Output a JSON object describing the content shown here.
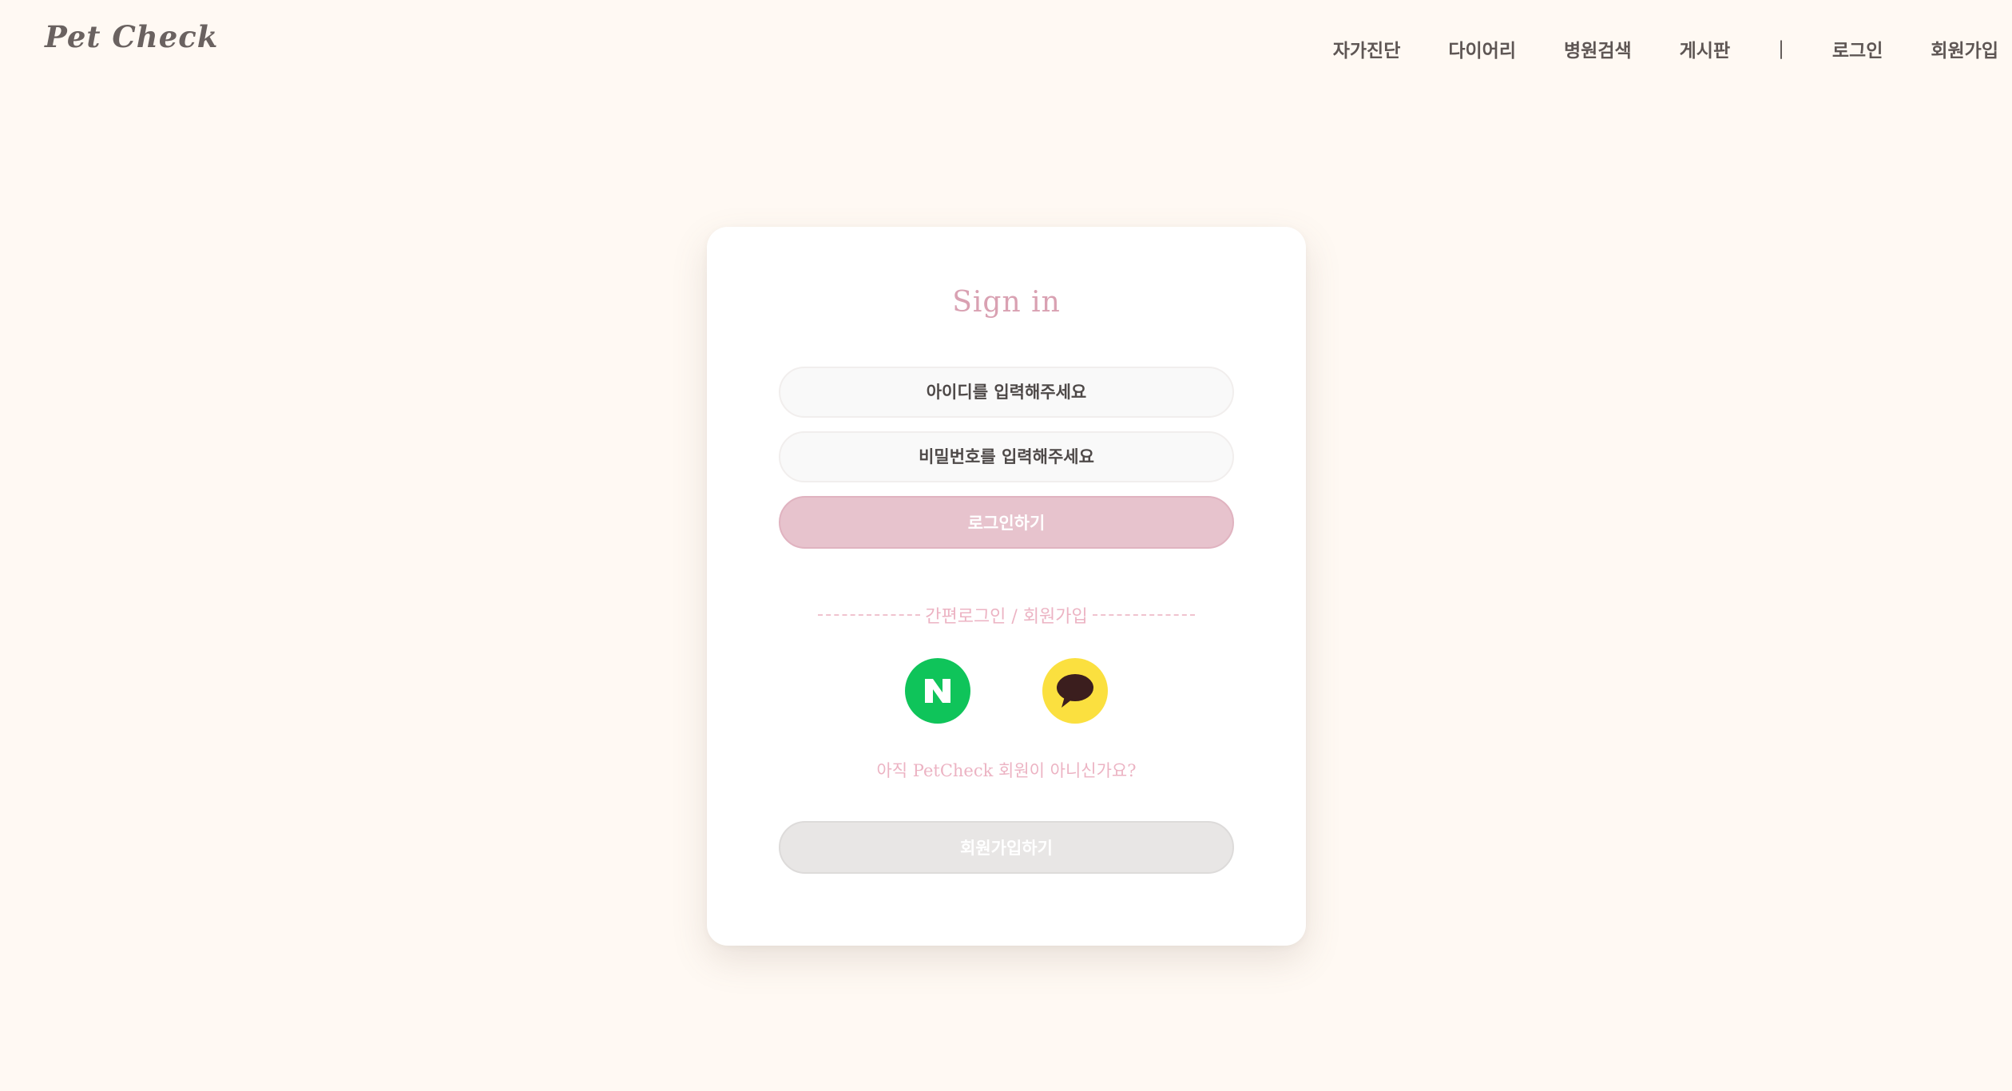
{
  "header": {
    "logo": "Pet Check",
    "nav": [
      {
        "label": "자가진단"
      },
      {
        "label": "다이어리"
      },
      {
        "label": "병원검색"
      },
      {
        "label": "게시판"
      }
    ],
    "separator": "|",
    "login": "로그인",
    "signup": "회원가입"
  },
  "card": {
    "title": "Sign in",
    "id_placeholder": "아이디를 입력해주세요",
    "pw_placeholder": "비밀번호를 입력해주세요",
    "login_button": "로그인하기",
    "divider_text": "간편로그인 / 회원가입",
    "social": [
      {
        "name": "naver",
        "icon": "naver-icon",
        "color": "#0fc45a",
        "glyph": "N"
      },
      {
        "name": "kakao",
        "icon": "kakao-icon",
        "color": "#fbe03f"
      }
    ],
    "signup_prompt": "아직 PetCheck 회원이 아니신가요?",
    "signup_button": "회원가입하기"
  },
  "colors": {
    "background": "#fff9f3",
    "accent_pink": "#e7c3cd",
    "title_pink": "#d9a1b2",
    "muted_button": "#e8e6e5"
  }
}
